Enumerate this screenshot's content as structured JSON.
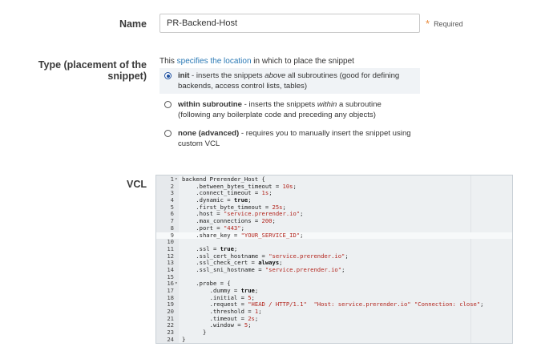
{
  "name_field": {
    "label": "Name",
    "value": "PR-Backend-Host",
    "required_text": "Required"
  },
  "type_field": {
    "label": "Type (placement of the snippet)",
    "desc_before": "This ",
    "desc_link": "specifies the location",
    "desc_after": " in which to place the snippet",
    "selected": "init",
    "options": [
      {
        "key": "init",
        "title": "init",
        "text_a": " - inserts the snippets ",
        "emph": "above",
        "text_b": " all subroutines (good for defining backends, access control lists, tables)"
      },
      {
        "key": "within",
        "title": "within subroutine",
        "text_a": " - inserts the snippets ",
        "emph": "within",
        "text_b": " a subroutine (following any boilerplate code and preceding any objects)"
      },
      {
        "key": "none",
        "title": "none (advanced)",
        "text_a": " - requires you to manually insert the snippet using custom VCL",
        "emph": "",
        "text_b": ""
      }
    ]
  },
  "vcl": {
    "label": "VCL",
    "active_line": 9,
    "lines": [
      "backend Prerender_Host {",
      "    .between_bytes_timeout = 10s;",
      "    .connect_timeout = 1s;",
      "    .dynamic = true;",
      "    .first_byte_timeout = 25s;",
      "    .host = \"service.prerender.io\";",
      "    .max_connections = 200;",
      "    .port = \"443\";",
      "    .share_key = \"YOUR_SERVICE_ID\";",
      "",
      "    .ssl = true;",
      "    .ssl_cert_hostname = \"service.prerender.io\";",
      "    .ssl_check_cert = always;",
      "    .ssl_sni_hostname = \"service.prerender.io\";",
      "",
      "    .probe = {",
      "        .dummy = true;",
      "        .initial = 5;",
      "        .request = \"HEAD / HTTP/1.1\"  \"Host: service.prerender.io\" \"Connection: close\";",
      "        .threshold = 1;",
      "        .timeout = 2s;",
      "        .window = 5;",
      "      }",
      "}"
    ],
    "fold_lines": [
      1,
      16
    ]
  }
}
